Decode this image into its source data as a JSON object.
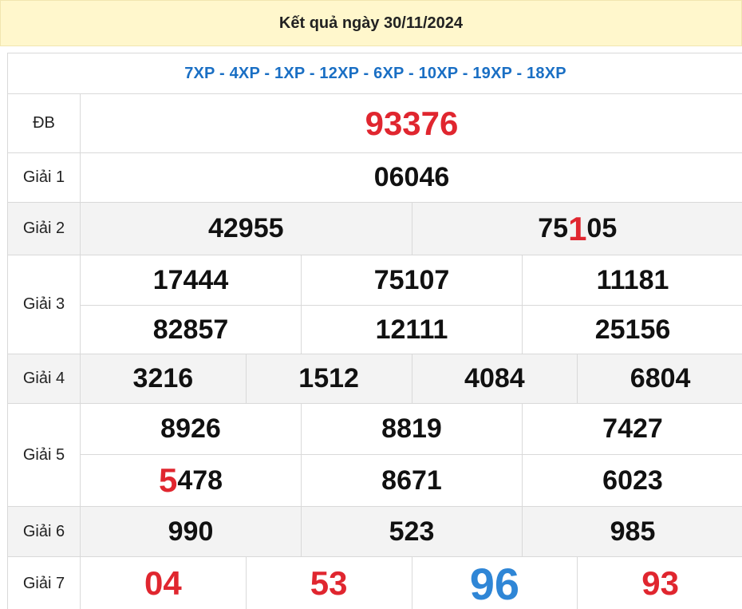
{
  "header": {
    "title": "Kết quả ngày 30/11/2024"
  },
  "codes": "7XP - 4XP - 1XP - 12XP - 6XP - 10XP - 19XP - 18XP",
  "prizes": {
    "db": {
      "label": "ĐB",
      "numbers": [
        "93376"
      ]
    },
    "g1": {
      "label": "Giải 1",
      "numbers": [
        "06046"
      ]
    },
    "g2": {
      "label": "Giải 2",
      "numbers": [
        "42955",
        "75105"
      ],
      "highlight": {
        "prefix": "75",
        "digit": "1",
        "suffix": "05"
      }
    },
    "g3": {
      "label": "Giải 3",
      "numbers": [
        "17444",
        "75107",
        "11181",
        "82857",
        "12111",
        "25156"
      ]
    },
    "g4": {
      "label": "Giải 4",
      "numbers": [
        "3216",
        "1512",
        "4084",
        "6804"
      ]
    },
    "g5": {
      "label": "Giải 5",
      "numbers": [
        "8926",
        "8819",
        "7427",
        "5478",
        "8671",
        "6023"
      ],
      "highlight": {
        "digit": "5",
        "suffix": "478"
      }
    },
    "g6": {
      "label": "Giải 6",
      "numbers": [
        "990",
        "523",
        "985"
      ]
    },
    "g7": {
      "label": "Giải 7",
      "numbers": [
        "04",
        "53",
        "96",
        "93"
      ]
    }
  },
  "colors": {
    "red": "#e0262f",
    "blue": "#2f86d6",
    "code_blue": "#1a6fc4",
    "header_bg": "#fff7cc",
    "shade_bg": "#f3f3f3"
  }
}
